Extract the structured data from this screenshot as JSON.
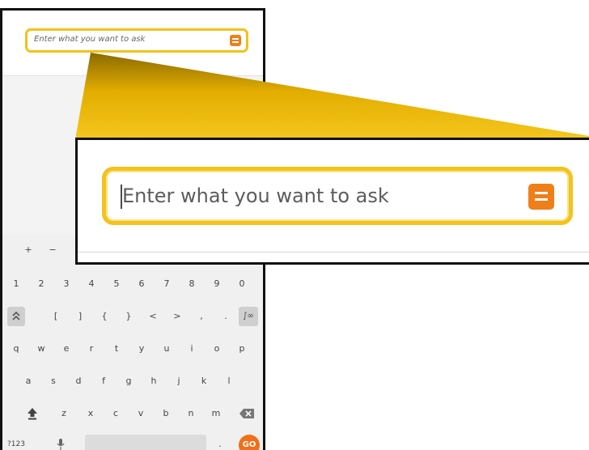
{
  "search": {
    "placeholder": "Enter what you want to ask",
    "button_icon": "menu-icon"
  },
  "colors": {
    "accent_border": "#f2c21a",
    "button": "#ef7f19",
    "go_key": "#ef7019"
  },
  "keyboard": {
    "symbols_row": [
      "+",
      "−",
      "*"
    ],
    "numbers_row": [
      "1",
      "2",
      "3",
      "4",
      "5",
      "6",
      "7",
      "8",
      "9",
      "0"
    ],
    "brackets_row": [
      "[",
      "]",
      "{",
      "}",
      "<",
      ">",
      ",",
      "."
    ],
    "brackets_row_left_icon": "expand-keyboard-icon",
    "brackets_row_right_key": "∫∞",
    "row_q": [
      "q",
      "w",
      "e",
      "r",
      "t",
      "y",
      "u",
      "i",
      "o",
      "p"
    ],
    "row_a": [
      "a",
      "s",
      "d",
      "f",
      "g",
      "h",
      "j",
      "k",
      "l"
    ],
    "row_z": [
      "z",
      "x",
      "c",
      "v",
      "b",
      "n",
      "m"
    ],
    "shift_icon": "shift-icon",
    "backspace_icon": "backspace-icon",
    "mode_key": "?123",
    "mic_icon": "microphone-icon",
    "period_key": ".",
    "go_key": "GO"
  }
}
